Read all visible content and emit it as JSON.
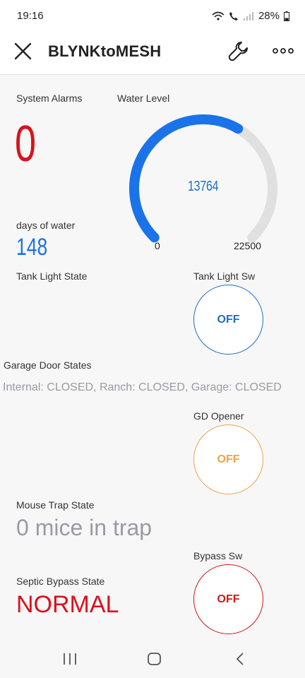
{
  "status": {
    "time": "19:16",
    "battery": "28%"
  },
  "header": {
    "title": "BLYNKtoMESH"
  },
  "widgets": {
    "system_alarms": {
      "label": "System Alarms",
      "value": "0"
    },
    "water_level": {
      "label": "Water Level",
      "value": "13764",
      "min": "0",
      "max": "22500",
      "level": 13764
    },
    "days_of_water": {
      "label": "days of water",
      "value": "148"
    },
    "tank_light_state": {
      "label": "Tank Light State"
    },
    "tank_light_sw": {
      "label": "Tank Light Sw",
      "button": "OFF"
    },
    "garage_door_states": {
      "label": "Garage Door States",
      "value": "Internal: CLOSED, Ranch: CLOSED, Garage: CLOSED"
    },
    "gd_opener": {
      "label": "GD Opener",
      "button": "OFF"
    },
    "mouse_trap_state": {
      "label": "Mouse Trap State",
      "value": "0 mice in trap"
    },
    "bypass_sw": {
      "label": "Bypass Sw",
      "button": "OFF"
    },
    "septic_bypass_state": {
      "label": "Septic Bypass State",
      "value": "NORMAL"
    }
  },
  "colors": {
    "gauge_fill": "#1a73e8",
    "gauge_track": "#e0e0e0",
    "alarm_red": "#d9121b",
    "tank_switch": "#1f6fbf",
    "gd_switch": "#f0a24a",
    "bypass_switch": "#c91a1a",
    "muted_gray": "#9a9aa6"
  }
}
